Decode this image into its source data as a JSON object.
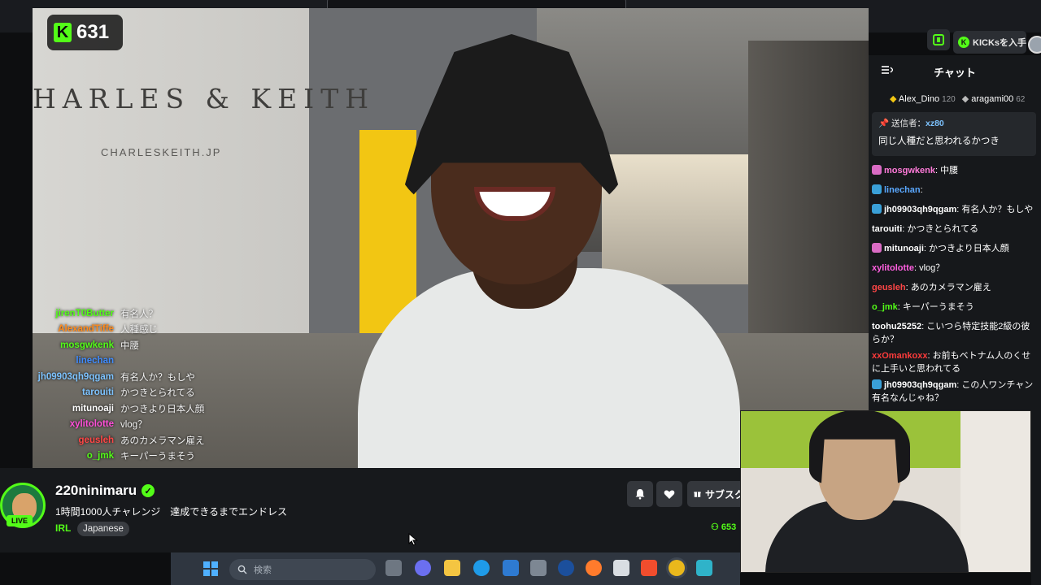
{
  "topbar": {
    "search_placeholder": "検索",
    "kicks_button": "KICKsを入手"
  },
  "video": {
    "viewer_count": "631",
    "brand_line1": "HARLES & KEITH",
    "brand_line2": "CHARLESKEITH.JP",
    "overlay_chat": [
      {
        "user": "jirenT0Butter",
        "msg": "有名人？",
        "color": "#53fc18"
      },
      {
        "user": "AlexandTiffe",
        "msg": "人種感じ",
        "color": "#ff8a1c"
      },
      {
        "user": "mosgwkenk",
        "msg": "中腰",
        "color": "#53fc18"
      },
      {
        "user": "linechan",
        "msg": "",
        "color": "#3f8cff"
      },
      {
        "user": "jh09903qh9qgam",
        "msg": "有名人か？もしや",
        "color": "#7dc3ff"
      },
      {
        "user": "tarouiti",
        "msg": "かつきとられてる",
        "color": "#7dc3ff"
      },
      {
        "user": "mitunoaji",
        "msg": "かつきより日本人顔",
        "color": "#ffffff"
      },
      {
        "user": "xylitolotte",
        "msg": "vlog？",
        "color": "#ff4fd8"
      },
      {
        "user": "geusleh",
        "msg": "あのカメラマン雇え",
        "color": "#ff4646"
      },
      {
        "user": "o_jmk",
        "msg": "キーパーうまそう",
        "color": "#53fc18"
      }
    ]
  },
  "chat": {
    "title": "チャット",
    "leaders": [
      {
        "name": "Alex_Dino",
        "points": "120"
      },
      {
        "name": "aragami00",
        "points": "62"
      }
    ],
    "pinned": {
      "label": "送信者：",
      "user": "xz80",
      "text": "同じ人種だと思われるかつき"
    },
    "messages": [
      {
        "user": "mosgwkenk",
        "text": "中腰",
        "color": "#ff7ad9",
        "badge": "#d96bc4"
      },
      {
        "user": "linechan",
        "text": "",
        "color": "#5aa8ff",
        "badge": "#3aa0d8"
      },
      {
        "user": "jh09903qh9qgam",
        "text": "有名人か？もしや",
        "color": "#ffffff",
        "badge": "#3aa0d8"
      },
      {
        "user": "tarouiti",
        "text": "かつきとられてる",
        "color": "#ffffff",
        "badge": ""
      },
      {
        "user": "mitunoaji",
        "text": "かつきより日本人顔",
        "color": "#ffffff",
        "badge": "#d96bc4"
      },
      {
        "user": "xylitolotte",
        "text": "vlog？",
        "color": "#ff5fe0",
        "badge": ""
      },
      {
        "user": "geusleh",
        "text": "あのカメラマン雇え",
        "color": "#ff4646",
        "badge": ""
      },
      {
        "user": "o_jmk",
        "text": "キーパーうまそう",
        "color": "#53fc18",
        "badge": ""
      },
      {
        "user": "toohu25252",
        "text": "こいつら特定技能2級の彼らか？",
        "color": "#ffffff",
        "badge": ""
      },
      {
        "user": "xxOmankoxx",
        "text": "お前もベトナム人のくせに上手いと思われてる",
        "color": "#ff3b3b",
        "badge": ""
      },
      {
        "user": "jh09903qh9qgam",
        "text": "この人ワンチャン有名なんじゃね？",
        "color": "#ffffff",
        "badge": "#3aa0d8"
      }
    ]
  },
  "channel": {
    "name": "220ninimaru",
    "live_label": "LIVE",
    "stream_title": "1時間1000人チャレンジ　達成できるまでエンドレス",
    "category": "IRL",
    "tag": "Japanese",
    "subscribe_label": "サブスク",
    "viewers": "653"
  },
  "taskbar": {
    "search_placeholder": "検索"
  },
  "colors": {
    "accent": "#53fc18",
    "panel": "#16181b",
    "taskbar": "#2f3640"
  }
}
